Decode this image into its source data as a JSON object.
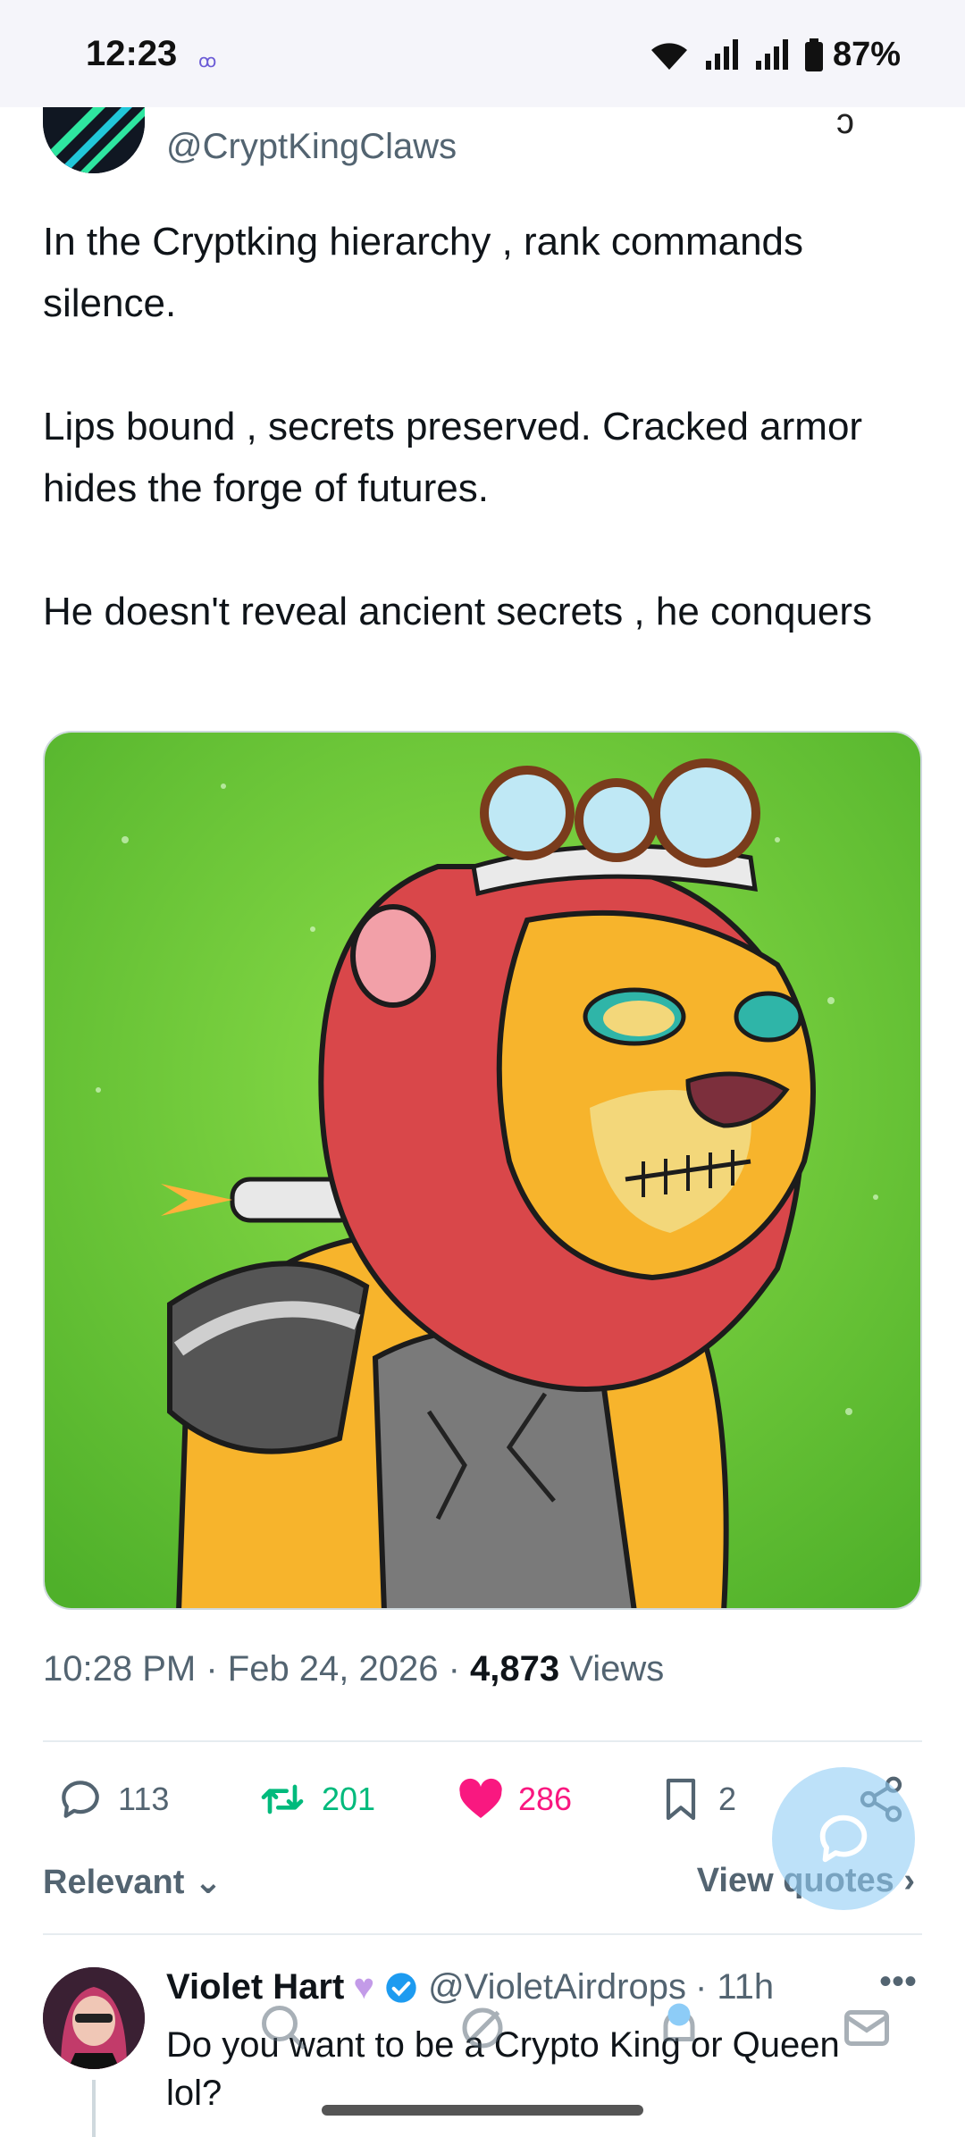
{
  "status_bar": {
    "time": "12:23",
    "battery": "87%",
    "icons": [
      "wifi-icon",
      "signal-icon",
      "signal-icon",
      "battery-icon"
    ]
  },
  "author": {
    "handle": "@CryptKingClaws",
    "verified": true
  },
  "tweet": {
    "paragraphs": [
      "In the Cryptking hierarchy , rank commands silence.",
      "Lips bound , secrets preserved. Cracked armor hides the forge of futures.",
      "He doesn't reveal ancient secrets , he conquers"
    ],
    "meta_prefix": "10:28 PM · Feb 24, 2026 · ",
    "views_count": "4,873",
    "views_label": " Views"
  },
  "actions": {
    "replies": "113",
    "reposts": "201",
    "likes": "286",
    "bookmarks": "2"
  },
  "sort": {
    "relevant_label": "Relevant",
    "view_quotes_label": "View quotes"
  },
  "reply": {
    "name": "Violet Hart",
    "handle": "@VioletAirdrops",
    "time": "· 11h",
    "text": "Do you want to be a Crypto King or Queen lol?"
  },
  "colors": {
    "like": "#f91880",
    "repost": "#00ba7c",
    "verified": "#1d9bf0",
    "secondary": "#536471"
  }
}
